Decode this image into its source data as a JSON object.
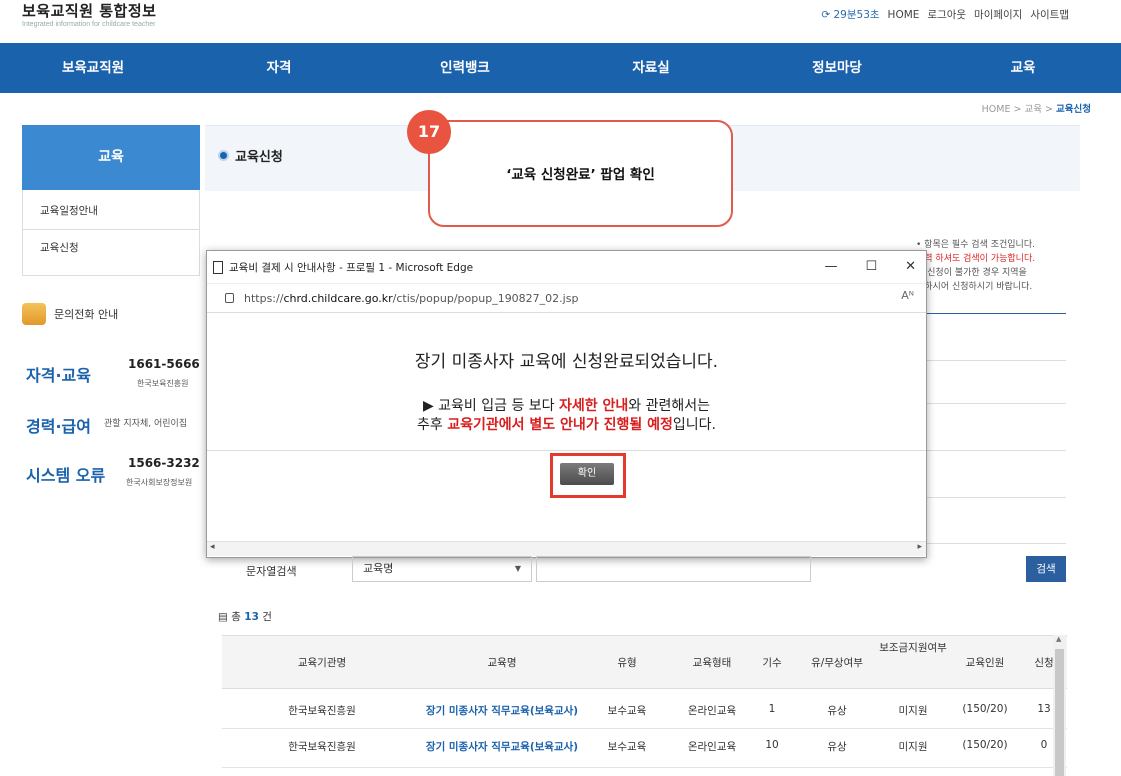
{
  "header": {
    "site_title": "보육교직원 통합정보",
    "site_subtitle": "Integrated information for childcare teacher",
    "clock": "29분53초",
    "util_links": [
      "HOME",
      "로그아웃",
      "마이페이지",
      "사이트맵"
    ]
  },
  "gnb": [
    "보육교직원",
    "자격",
    "인력뱅크",
    "자료실",
    "정보마당",
    "교육"
  ],
  "breadcrumb": {
    "home": "HOME",
    "sep": ">",
    "section": "교육",
    "current": "교육신청"
  },
  "lnb": {
    "title": "교육",
    "items": [
      "교육일정안내",
      "교육신청"
    ]
  },
  "inquiry": {
    "title": "문의전화 안내",
    "contacts": [
      {
        "name": "자격·교육",
        "number": "1661-5666",
        "org": "한국보육진흥원"
      },
      {
        "name": "경력·급여",
        "number": "",
        "org": "관할 지자체, 어린이집"
      },
      {
        "name": "시스템 오류",
        "number": "1566-3232",
        "org": "한국사회보장정보원"
      }
    ]
  },
  "content": {
    "title": "교육신청",
    "notes": [
      "• 항목은 필수 검색 조건입니다.",
      "입력 하셔도 검색이 가능합니다.",
      "아 신청이 불가한 경우 지역을",
      "력하시어 신청하시기 바랍니다."
    ]
  },
  "callout": {
    "number": "17",
    "text": "‘교육 신청완료’  팝업 확인"
  },
  "popup": {
    "window_title": "교육비 결제 시 안내사항 - 프로필 1 - Microsoft Edge",
    "url_prefix": "https://",
    "url_host": "chrd.childcare.go.kr",
    "url_path": "/ctis/popup/popup_190827_02.jsp",
    "reader_icon": "Aᴺ",
    "message_main": "장기 미종사자 교육에 신청완료되었습니다.",
    "line2_a": "▶ 교육비 입금 등 보다 ",
    "line2_b": "자세한 안내",
    "line2_c": "와 관련해서는",
    "line3_a": "추후 ",
    "line3_b": "교육기관에서 별도 안내가 진행될 예정",
    "line3_c": "입니다.",
    "ok_label": "확인",
    "win_min": "—",
    "win_max": "☐",
    "win_close": "✕"
  },
  "search": {
    "label": "문자열검색",
    "select_value": "교육명",
    "button": "검색"
  },
  "total": {
    "prefix": "총",
    "count": "13",
    "suffix": "건"
  },
  "table": {
    "headers": [
      "교육기관명",
      "교육명",
      "유형",
      "교육형태",
      "기수",
      "유/무상여부",
      "보조금지원여부",
      "교육인원",
      "신청"
    ],
    "rows": [
      [
        "한국보육진흥원",
        "장기 미종사자 직무교육(보육교사)",
        "보수교육",
        "온라인교육",
        "1",
        "유상",
        "미지원",
        "(150/20)",
        "13"
      ],
      [
        "한국보육진흥원",
        "장기 미종사자 직무교육(보육교사)",
        "보수교육",
        "온라인교육",
        "10",
        "유상",
        "미지원",
        "(150/20)",
        "0"
      ]
    ]
  }
}
